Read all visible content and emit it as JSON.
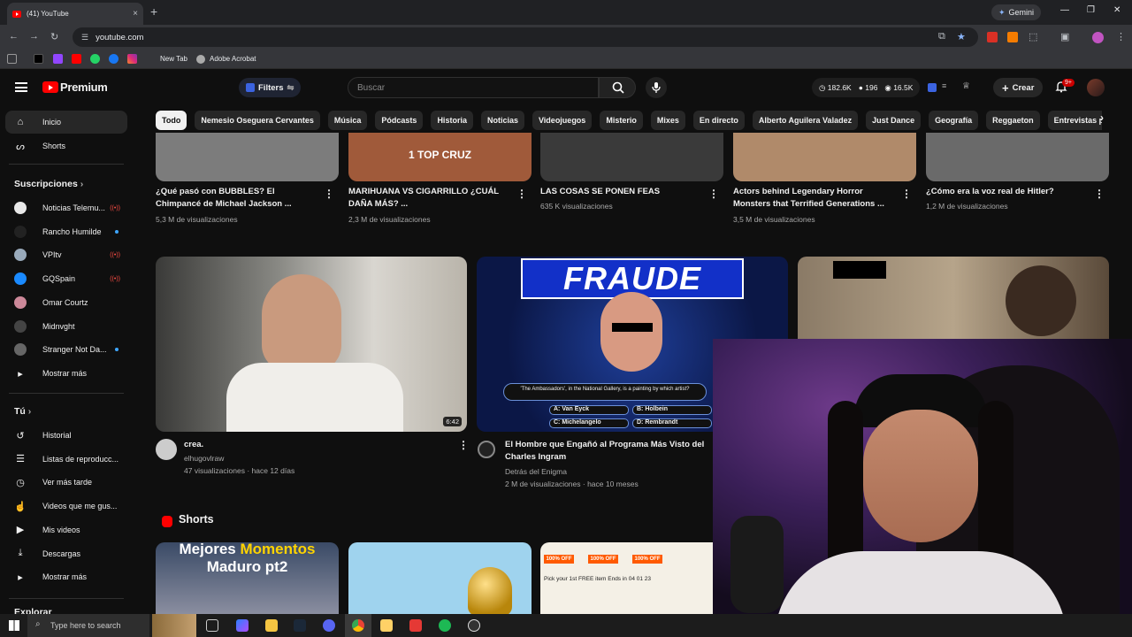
{
  "browser": {
    "tab_title": "(41) YouTube",
    "tab_close": "×",
    "new_tab": "+",
    "gemini_label": "Gemini",
    "url": "youtube.com",
    "bookmarks": [
      "New Tab",
      "Adobe Acrobat"
    ]
  },
  "header": {
    "logo_text": "Premium",
    "filters_label": "Filters",
    "search_placeholder": "Buscar",
    "stats": [
      "182.6K",
      "196",
      "16.5K"
    ],
    "create_label": "Crear",
    "notif_badge": "9+"
  },
  "chips": [
    "Todo",
    "Nemesio Oseguera Cervantes",
    "Música",
    "Pódcasts",
    "Historia",
    "Noticias",
    "Videojuegos",
    "Misterio",
    "Mixes",
    "En directo",
    "Alberto Aguilera Valadez",
    "Just Dance",
    "Geografía",
    "Reggaeton",
    "Entrevistas p"
  ],
  "sidebar": {
    "top": [
      {
        "label": "Inicio",
        "icon": "home-icon"
      },
      {
        "label": "Shorts",
        "icon": "shorts-icon"
      }
    ],
    "subs_header": "Suscripciones",
    "subs": [
      {
        "label": "Noticias Telemu...",
        "color": "#e8e8e8",
        "status": "live"
      },
      {
        "label": "Rancho Humilde",
        "color": "#222",
        "status": "dot"
      },
      {
        "label": "VPItv",
        "color": "#9ab",
        "status": "live"
      },
      {
        "label": "GQSpain",
        "color": "#1a8aff",
        "status": "live"
      },
      {
        "label": "Omar Courtz",
        "color": "#c89",
        "status": ""
      },
      {
        "label": "Midnvght",
        "color": "#444",
        "status": ""
      },
      {
        "label": "Stranger Not Da...",
        "color": "#666",
        "status": "dot"
      }
    ],
    "subs_more": "Mostrar más",
    "you_header": "Tú",
    "you": [
      {
        "label": "Historial",
        "icon": "history-icon"
      },
      {
        "label": "Listas de reproducc...",
        "icon": "playlist-icon"
      },
      {
        "label": "Ver más tarde",
        "icon": "clock-icon"
      },
      {
        "label": "Videos que me gus...",
        "icon": "like-icon"
      },
      {
        "label": "Mis videos",
        "icon": "my-videos-icon"
      },
      {
        "label": "Descargas",
        "icon": "download-icon"
      }
    ],
    "you_more": "Mostrar más",
    "explore": "Explorar"
  },
  "row1": [
    {
      "title1": "¿Qué pasó con BUBBLES? El",
      "title2": "Chimpancé de Michael Jackson ...",
      "meta": "5,3 M de visualizaciones",
      "color": "#7c7c7c"
    },
    {
      "title1": "MARIHUANA VS CIGARRILLO ¿CUÁL",
      "title2": "DAÑA MÁS? ...",
      "meta": "2,3 M de visualizaciones",
      "color": "#a05a3a",
      "overlay": "1 TOP CRUZ"
    },
    {
      "title1": "LAS COSAS SE PONEN FEAS",
      "title2": "",
      "meta": "635 K visualizaciones",
      "color": "#3a3a3a"
    },
    {
      "title1": "Actors behind Legendary Horror",
      "title2": "Monsters that Terrified Generations ...",
      "meta": "3,5 M de visualizaciones",
      "color": "#b08a6a"
    },
    {
      "title1": "¿Cómo era la voz real de Hitler?",
      "title2": "",
      "meta": "1,2 M de visualizaciones",
      "color": "#6a6a6a"
    }
  ],
  "row2": [
    {
      "title": "crea.",
      "channel": "elhugovlraw",
      "meta": "47 visualizaciones · hace 12 días",
      "duration": "6:42"
    },
    {
      "title": "El Hombre que Engañó al Programa Más Visto del",
      "title2": "Charles Ingram",
      "channel": "Detrás del Enigma",
      "meta": "2 M de visualizaciones · hace 10 meses",
      "overlay": "FRAUDE",
      "question": "'The Ambassadors', in the National Gallery, is a painting by which artist?",
      "answers": [
        "A: Van Eyck",
        "B: Holbein",
        "C: Michelangelo",
        "D: Rembrandt"
      ]
    }
  ],
  "shorts": {
    "label": "Shorts",
    "items": [
      {
        "title1": "Mejores",
        "title2": "Momentos",
        "title3": "Maduro pt2"
      },
      {
        "title1": ""
      },
      {
        "badges": [
          "100% OFF",
          "100% OFF",
          "100% OFF"
        ],
        "line": "Pick your 1st FREE item  Ends in 04 01 23"
      }
    ]
  },
  "taskbar": {
    "search": "Type here to search"
  }
}
